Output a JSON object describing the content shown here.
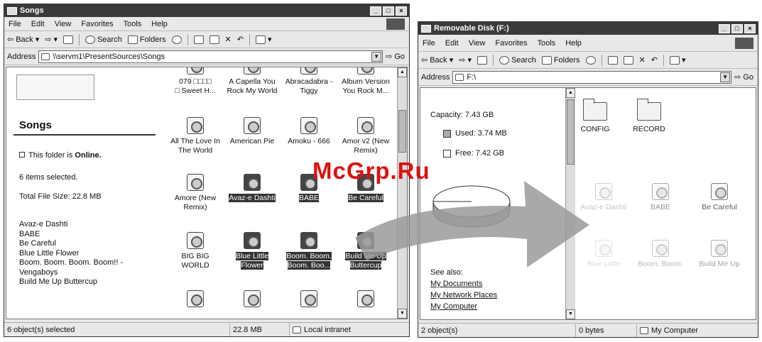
{
  "left": {
    "title": "Songs",
    "menu": [
      "File",
      "Edit",
      "View",
      "Favorites",
      "Tools",
      "Help"
    ],
    "toolbar": {
      "back": "Back",
      "search": "Search",
      "folders": "Folders"
    },
    "address_label": "Address",
    "address": "\\\\servm1\\PresentSources\\Songs",
    "go": "Go",
    "panel": {
      "heading": "Songs",
      "online_prefix": "This folder is ",
      "online_word": "Online.",
      "selected": "6 items selected.",
      "size": "Total File Size: 22.8 MB",
      "names": [
        "Avaz-e Dashti",
        "BABE",
        "Be Careful",
        "Blue Little Flower",
        "Boom. Boom. Boom. Boom!! -",
        "Vengaboys",
        "Build Me Up Buttercup"
      ]
    },
    "files": [
      {
        "l1": "079 □□□□",
        "l2": "□ Sweet H...",
        "sel": false
      },
      {
        "l1": "A Capella You",
        "l2": "Rock My World",
        "sel": false
      },
      {
        "l1": "Abracadabra -",
        "l2": "Tiggy",
        "sel": false
      },
      {
        "l1": "Album Version",
        "l2": "You Rock M...",
        "sel": false
      },
      {
        "l1": "All The Love In",
        "l2": "The World",
        "sel": false
      },
      {
        "l1": "American Pie",
        "l2": "",
        "sel": false
      },
      {
        "l1": "Amoku - 666",
        "l2": "",
        "sel": false
      },
      {
        "l1": "Amor v2 (New",
        "l2": "Remix)",
        "sel": false
      },
      {
        "l1": "Amore (New",
        "l2": "Remix)",
        "sel": false
      },
      {
        "l1": "Avaz-e Dashti",
        "l2": "",
        "sel": true
      },
      {
        "l1": "BABE",
        "l2": "",
        "sel": true
      },
      {
        "l1": "Be Careful",
        "l2": "",
        "sel": true
      },
      {
        "l1": "BIG BIG",
        "l2": "WORLD",
        "sel": false
      },
      {
        "l1": "Blue Little",
        "l2": "Flower",
        "sel": true
      },
      {
        "l1": "Boom. Boom.",
        "l2": "Boom. Boo...",
        "sel": true
      },
      {
        "l1": "Build Me Up",
        "l2": "Buttercup",
        "sel": true
      }
    ],
    "status": {
      "count": "6 object(s) selected",
      "size": "22.8 MB",
      "zone": "Local intranet"
    }
  },
  "right": {
    "title": "Removable Disk (F:)",
    "menu": [
      "File",
      "Edit",
      "View",
      "Favorites",
      "Tools",
      "Help"
    ],
    "toolbar": {
      "back": "Back",
      "search": "Search",
      "folders": "Folders"
    },
    "address_label": "Address",
    "address": "F:\\",
    "go": "Go",
    "panel": {
      "capacity": "Capacity: 7.43 GB",
      "used": "Used: 3.74 MB",
      "free": "Free: 7.42 GB",
      "used_fraction": 0.0005,
      "see_also": "See also:",
      "links": [
        "My Documents",
        "My Network Places",
        "My Computer"
      ]
    },
    "folders": [
      "CONFIG",
      "RECORD"
    ],
    "ghost_files": [
      {
        "label": "Avaz-e Dashti"
      },
      {
        "label": "BABE"
      },
      {
        "label": "Be Careful"
      },
      {
        "label": "Blue Little"
      },
      {
        "label": "Boom. Boom."
      },
      {
        "label": "Build Me Up"
      }
    ],
    "status": {
      "count": "2 object(s)",
      "size": "0 bytes",
      "zone": "My Computer"
    }
  },
  "watermark": "McGrp.Ru"
}
